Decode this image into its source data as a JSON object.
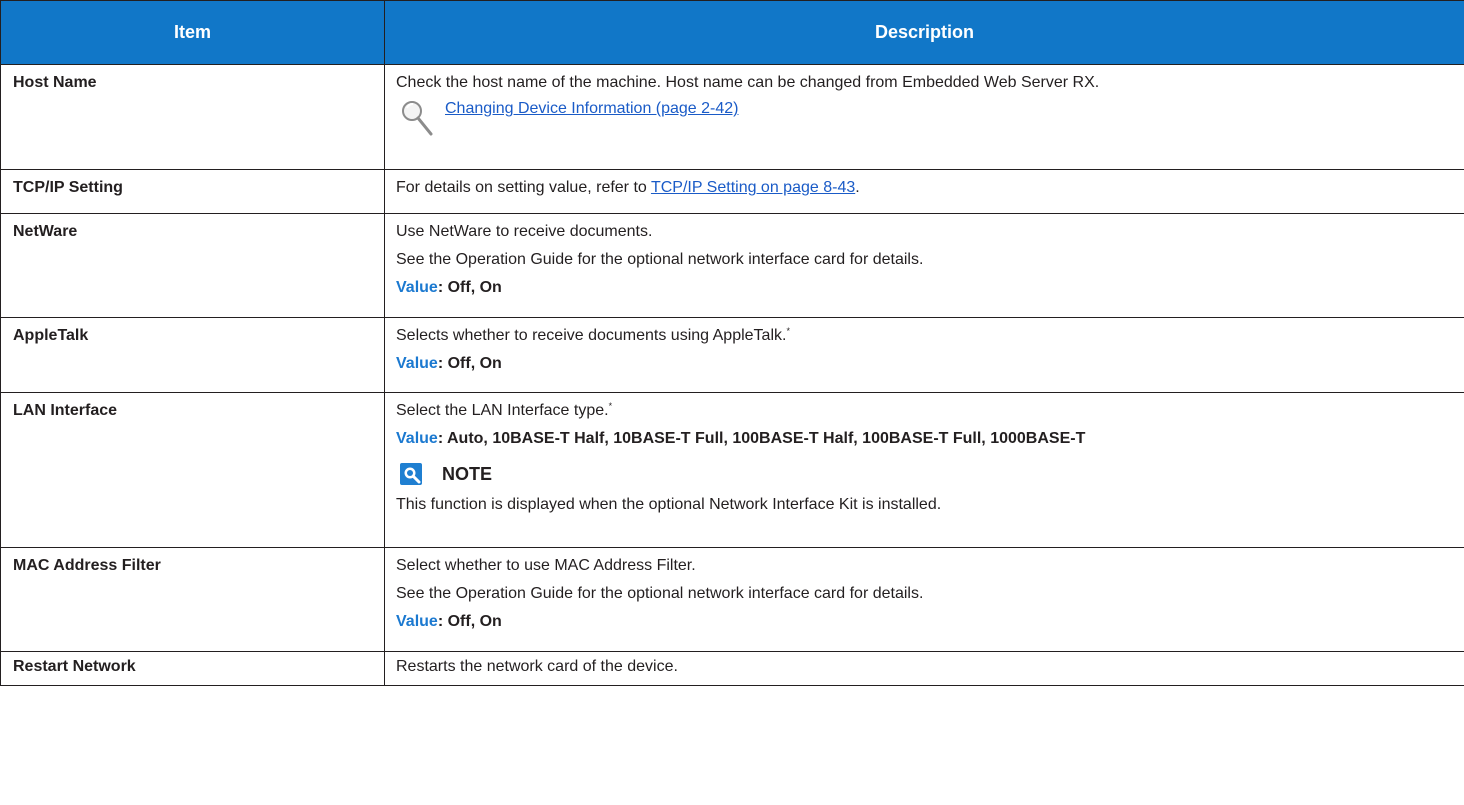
{
  "header": {
    "item": "Item",
    "description": "Description"
  },
  "rows": {
    "host_name": {
      "item": "Host Name",
      "text": "Check the host name of the machine. Host name can be changed from Embedded Web Server RX.",
      "link": "Changing Device Information (page 2-42)"
    },
    "tcpip": {
      "item": "TCP/IP Setting",
      "text_before": "For details on setting value, refer to ",
      "link": "TCP/IP Setting on page 8-43",
      "text_after": "."
    },
    "netware": {
      "item": "NetWare",
      "line1": "Use NetWare to receive documents.",
      "line2": "See the Operation Guide for the optional network interface card for details.",
      "value_label": "Value",
      "value_text": ": Off, On"
    },
    "appletalk": {
      "item": "AppleTalk",
      "line1": "Selects whether to receive documents using AppleTalk.",
      "footnote": "*",
      "value_label": "Value",
      "value_text": ": Off, On"
    },
    "lan": {
      "item": "LAN Interface",
      "line1": "Select the LAN Interface type.",
      "footnote": "*",
      "value_label": "Value",
      "value_text": ": Auto, 10BASE-T Half, 10BASE-T Full, 100BASE-T Half, 100BASE-T Full, 1000BASE-T",
      "note_heading": "NOTE",
      "note_text": "This function is displayed when the optional Network Interface Kit is installed."
    },
    "mac": {
      "item": "MAC Address Filter",
      "line1": "Select whether to use MAC Address Filter.",
      "line2": "See the Operation Guide for the optional network interface card for details.",
      "value_label": "Value",
      "value_text": ": Off, On"
    },
    "restart": {
      "item": "Restart Network",
      "text": "Restarts the network card of the device."
    }
  },
  "icons": {
    "reference": "magnifier-icon",
    "note": "note-icon"
  },
  "colors": {
    "header_bg": "#1177c8",
    "value_label": "#1b79d0",
    "link": "#1a5bc7",
    "note_icon": "#1f7fd1"
  }
}
